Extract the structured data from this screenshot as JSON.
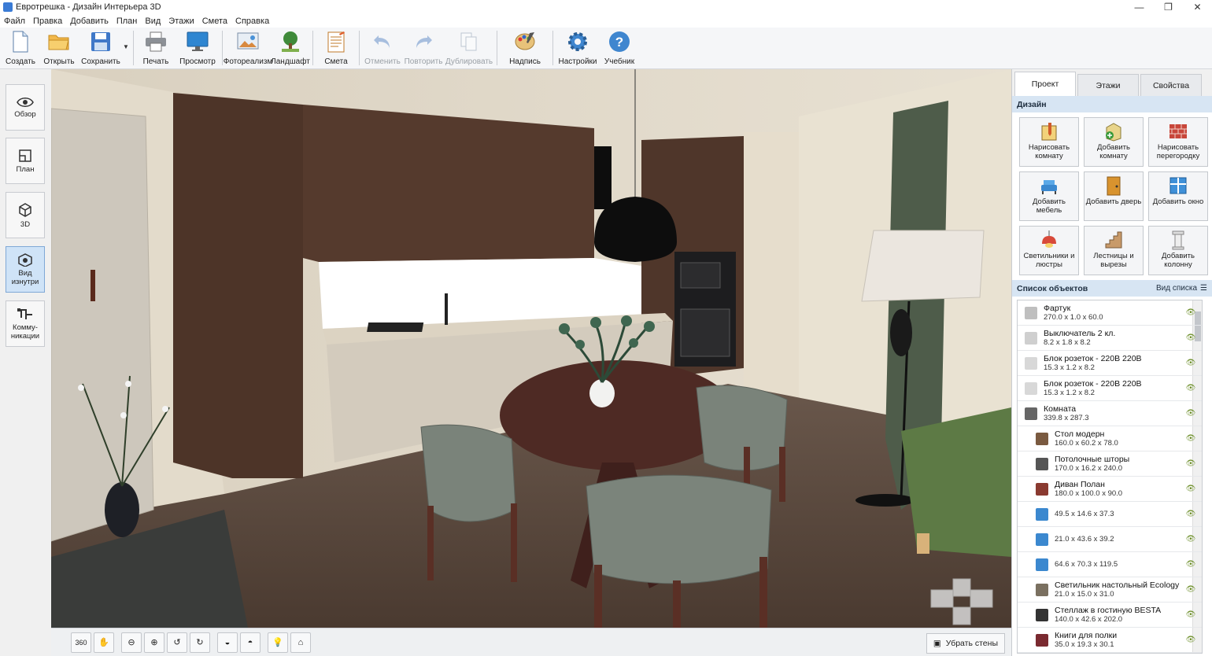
{
  "window": {
    "title": "Евротрешка - Дизайн Интерьера 3D",
    "controls": [
      "—",
      "❐",
      "✕"
    ]
  },
  "menu": [
    "Файл",
    "Правка",
    "Добавить",
    "План",
    "Вид",
    "Этажи",
    "Смета",
    "Справка"
  ],
  "toolbar": {
    "create": "Создать",
    "open": "Открыть",
    "save": "Сохранить",
    "print": "Печать",
    "preview": "Просмотр",
    "photoreal": "Фотореализм",
    "landscape": "Ландшафт",
    "estimate": "Смета",
    "undo": "Отменить",
    "redo": "Повторить",
    "duplicate": "Дублировать",
    "caption": "Надпись",
    "settings": "Настройки",
    "tutorial": "Учебник"
  },
  "left_nav": [
    {
      "label": "Обзор"
    },
    {
      "label": "План"
    },
    {
      "label": "3D"
    },
    {
      "label": "Вид изнутри",
      "active": true
    },
    {
      "label": "Комму-никации"
    }
  ],
  "viewport": {
    "walls_button": "Убрать стены"
  },
  "right_panel": {
    "tabs": [
      "Проект",
      "Этажи",
      "Свойства"
    ],
    "active_tab": "Проект",
    "design_section": "Дизайн",
    "design_buttons": [
      "Нарисовать комнату",
      "Добавить комнату",
      "Нарисовать перегородку",
      "Добавить мебель",
      "Добавить дверь",
      "Добавить окно",
      "Светильники и люстры",
      "Лестницы и вырезы",
      "Добавить колонну"
    ],
    "objects_title": "Список объектов",
    "list_view": "Вид списка",
    "objects": [
      {
        "name": "Фартук",
        "dims": "270.0 x 1.0 x 60.0",
        "indent": false
      },
      {
        "name": "Выключатель 2 кл.",
        "dims": "8.2 x 1.8 x 8.2",
        "indent": false
      },
      {
        "name": "Блок розеток - 220В 220В",
        "dims": "15.3 x 1.2 x 8.2",
        "indent": false
      },
      {
        "name": "Блок розеток - 220В 220В",
        "dims": "15.3 x 1.2 x 8.2",
        "indent": false
      },
      {
        "name": "Комната",
        "dims": "339.8 x 287.3",
        "indent": false
      },
      {
        "name": "Стол модерн",
        "dims": "160.0 x 60.2 x 78.0",
        "indent": true
      },
      {
        "name": "Потолочные шторы",
        "dims": "170.0 x 16.2 x 240.0",
        "indent": true
      },
      {
        "name": "Диван Полан",
        "dims": "180.0 x 100.0 x 90.0",
        "indent": true
      },
      {
        "name": "",
        "dims": "49.5 x 14.6 x 37.3",
        "indent": true
      },
      {
        "name": "",
        "dims": "21.0 x 43.6 x 39.2",
        "indent": true
      },
      {
        "name": "",
        "dims": "64.6 x 70.3 x 119.5",
        "indent": true
      },
      {
        "name": "Светильник настольный Ecology",
        "dims": "21.0 x 15.0 x 31.0",
        "indent": true
      },
      {
        "name": "Стеллаж в гостиную BESTA",
        "dims": "140.0 x 42.6 x 202.0",
        "indent": true
      },
      {
        "name": "Книги для полки",
        "dims": "35.0 x 19.3 x 30.1",
        "indent": true
      }
    ]
  },
  "colors": {
    "active_nav": "#cfe3f7",
    "section_header": "#d7e5f3",
    "accent": "#3a7bd5"
  }
}
